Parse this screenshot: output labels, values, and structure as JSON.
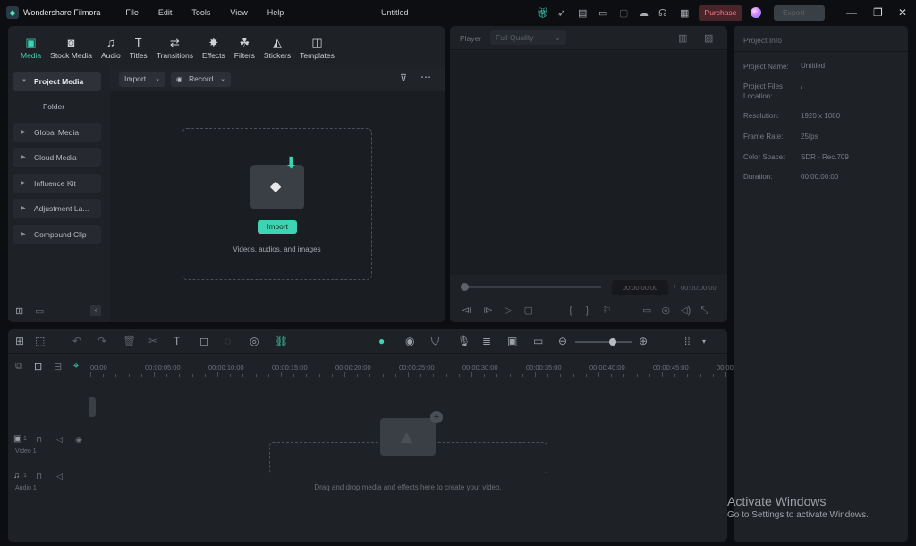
{
  "app": {
    "name": "Wondershare Filmora",
    "title": "Untitled",
    "menu": [
      "File",
      "Edit",
      "Tools",
      "View",
      "Help"
    ],
    "purchase": "Purchase",
    "export": "Export",
    "accent": "#3ed4b3",
    "purchase_color": "#ff7c8a"
  },
  "tabs": [
    {
      "label": "Media",
      "icon": "media-icon",
      "glyph": "▣",
      "active": true
    },
    {
      "label": "Stock Media",
      "icon": "stock-media-icon",
      "glyph": "◙"
    },
    {
      "label": "Audio",
      "icon": "music-note-icon",
      "glyph": "♫"
    },
    {
      "label": "Titles",
      "icon": "text-t-icon",
      "glyph": "T"
    },
    {
      "label": "Transitions",
      "icon": "transitions-icon",
      "glyph": "⇄"
    },
    {
      "label": "Effects",
      "icon": "effects-sparkle-icon",
      "glyph": "✸"
    },
    {
      "label": "Filters",
      "icon": "filters-icon",
      "glyph": "☘"
    },
    {
      "label": "Stickers",
      "icon": "stickers-icon",
      "glyph": "◭"
    },
    {
      "label": "Templates",
      "icon": "templates-icon",
      "glyph": "◫"
    }
  ],
  "sidebar": {
    "items": [
      "Project Media",
      "Folder",
      "Global Media",
      "Cloud Media",
      "Influence Kit",
      "Adjustment La...",
      "Compound Clip"
    ]
  },
  "media": {
    "import": "Import",
    "record": "Record",
    "import_button": "Import",
    "drop_text": "Videos, audios, and images"
  },
  "player": {
    "label": "Player",
    "quality": "Full Quality",
    "current_time": "00:00:00:00",
    "total_time": "00:00:00:00",
    "separator": "/",
    "progress": 0
  },
  "project_info": {
    "title": "Project Info",
    "rows": [
      {
        "label": "Project Name:",
        "value": "Untitled"
      },
      {
        "label": "Project Files Location:",
        "value": "/"
      },
      {
        "label": "Resolution:",
        "value": "1920 x 1080"
      },
      {
        "label": "Frame Rate:",
        "value": "25fps"
      },
      {
        "label": "Color Space:",
        "value": "SDR - Rec.709"
      },
      {
        "label": "Duration:",
        "value": "00:00:00:00"
      }
    ]
  },
  "timeline": {
    "ruler": [
      "00:00",
      "00:00:05:00",
      "00:00:10:00",
      "00:00:15:00",
      "00:00:20:00",
      "00:00:25:00",
      "00:00:30:00",
      "00:00:35:00",
      "00:00:40:00",
      "00:00:45:00",
      "00:00:"
    ],
    "tracks": [
      {
        "name": "Video 1",
        "num": "1"
      },
      {
        "name": "Audio 1",
        "num": "1"
      }
    ],
    "drop_text": "Drag and drop media and effects here to create your video.",
    "zoom_level": 0.6
  },
  "watermark": {
    "line1": "Activate Windows",
    "line2": "Go to Settings to activate Windows."
  }
}
